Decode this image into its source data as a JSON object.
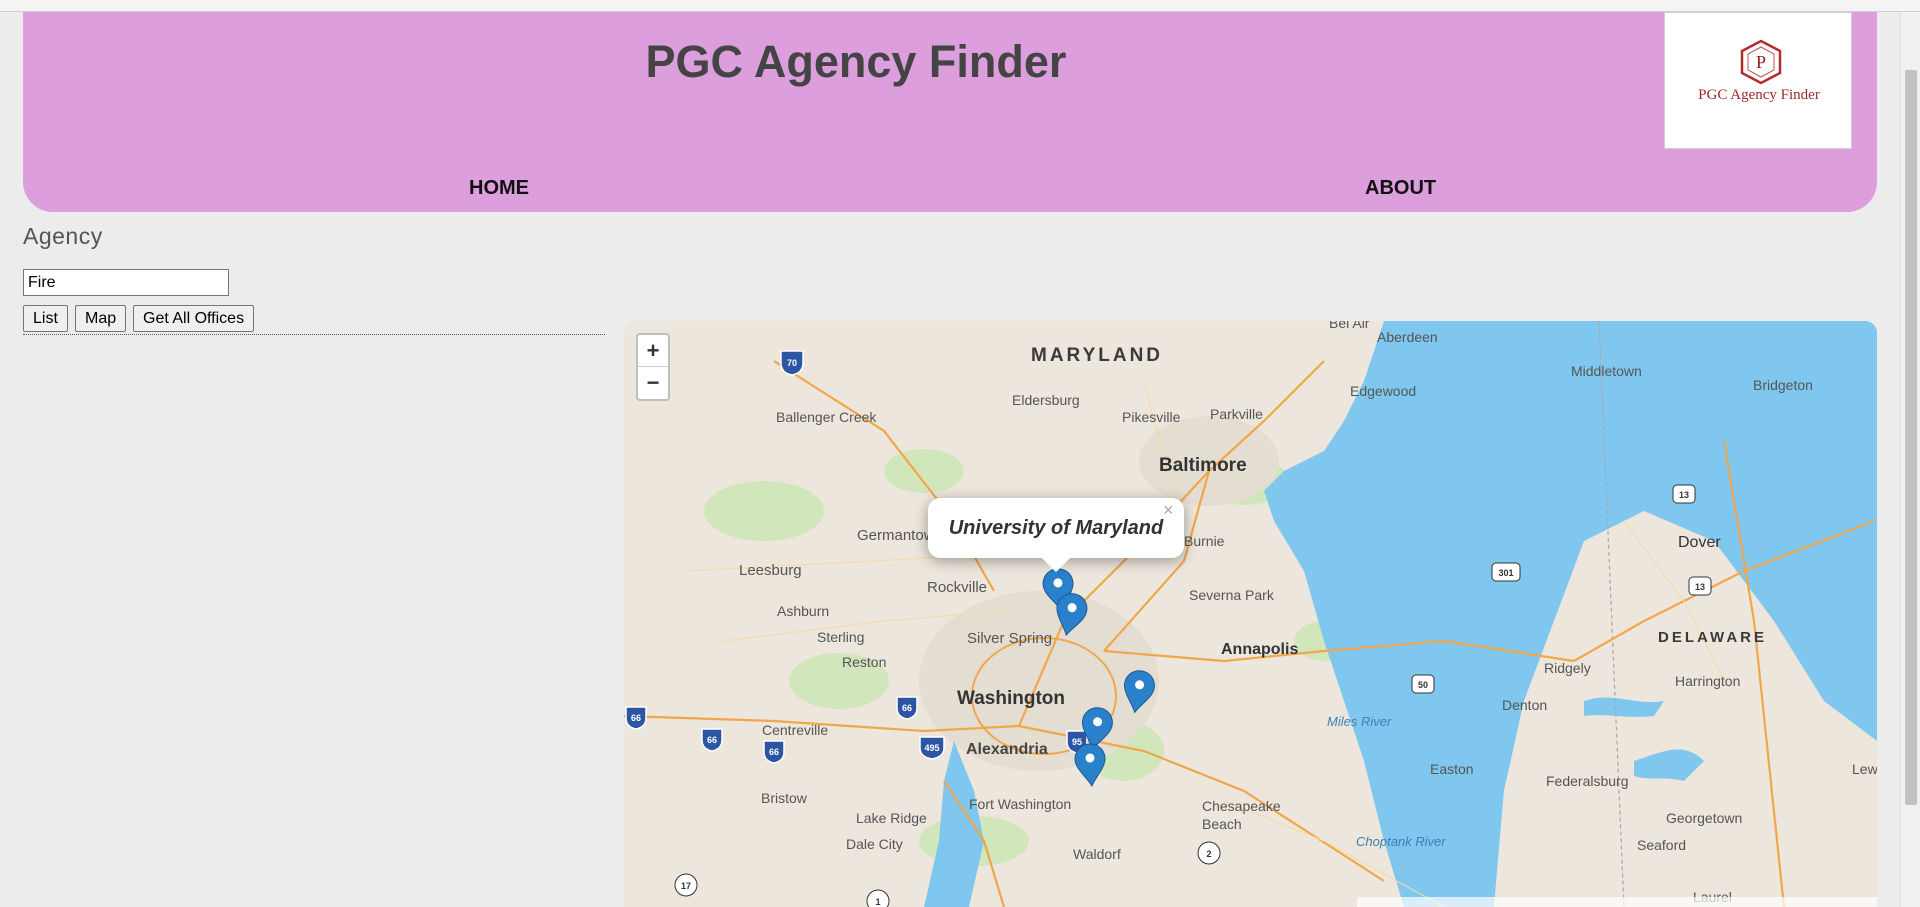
{
  "header": {
    "title": "PGC Agency Finder",
    "logo_text": "PGC Agency Finder",
    "logo_letter": "P",
    "nav": [
      {
        "label": "HOME"
      },
      {
        "label": "ABOUT"
      }
    ]
  },
  "search": {
    "label": "Agency",
    "value": "Fire",
    "buttons": {
      "list": "List",
      "map": "Map",
      "all": "Get All Offices"
    }
  },
  "map": {
    "zoom_in": "+",
    "zoom_out": "−",
    "popup": {
      "text": "University of Maryland",
      "close": "×"
    },
    "labels": {
      "maryland": "MARYLAND",
      "delaware": "DELAWARE",
      "baltimore": "Baltimore",
      "washington": "Washington",
      "annapolis": "Annapolis",
      "alexandria": "Alexandria",
      "silver_spring": "Silver Spring",
      "rockville": "Rockville",
      "germantown": "Germantown",
      "leesburg": "Leesburg",
      "ashburn": "Ashburn",
      "sterling": "Sterling",
      "reston": "Reston",
      "centreville": "Centreville",
      "bristow": "Bristow",
      "lake_ridge": "Lake Ridge",
      "dale_city": "Dale City",
      "fort_washington": "Fort Washington",
      "waldorf": "Waldorf",
      "chesapeake_beach": "Chesapeake Beach",
      "severna_park": "Severna Park",
      "glen_burnie": "Burnie",
      "bel_air": "Bel Air",
      "aberdeen": "Aberdeen",
      "edgewood": "Edgewood",
      "eldersburg": "Eldersburg",
      "ballenger_creek": "Ballenger Creek",
      "pikesville": "Pikesville",
      "parkville": "Parkville",
      "middletown": "Middletown",
      "bridgeton": "Bridgeton",
      "dover": "Dover",
      "harrington": "Harrington",
      "ridgely": "Ridgely",
      "denton": "Denton",
      "easton": "Easton",
      "federalsburg": "Federalsburg",
      "georgetown": "Georgetown",
      "seaford": "Seaford",
      "laurel": "Laurel",
      "lew": "Lew",
      "miles_river": "Miles River",
      "choptank_river": "Choptank River"
    },
    "shields": [
      "70",
      "66",
      "66",
      "66",
      "66",
      "495",
      "95",
      "13",
      "13",
      "301",
      "50",
      "2",
      "17",
      "1"
    ]
  },
  "colors": {
    "header_bg": "#dd9edd",
    "page_bg": "#ececec",
    "water": "#7fc7ee",
    "land": "#ece6dc",
    "marker": "#2a81cb"
  }
}
